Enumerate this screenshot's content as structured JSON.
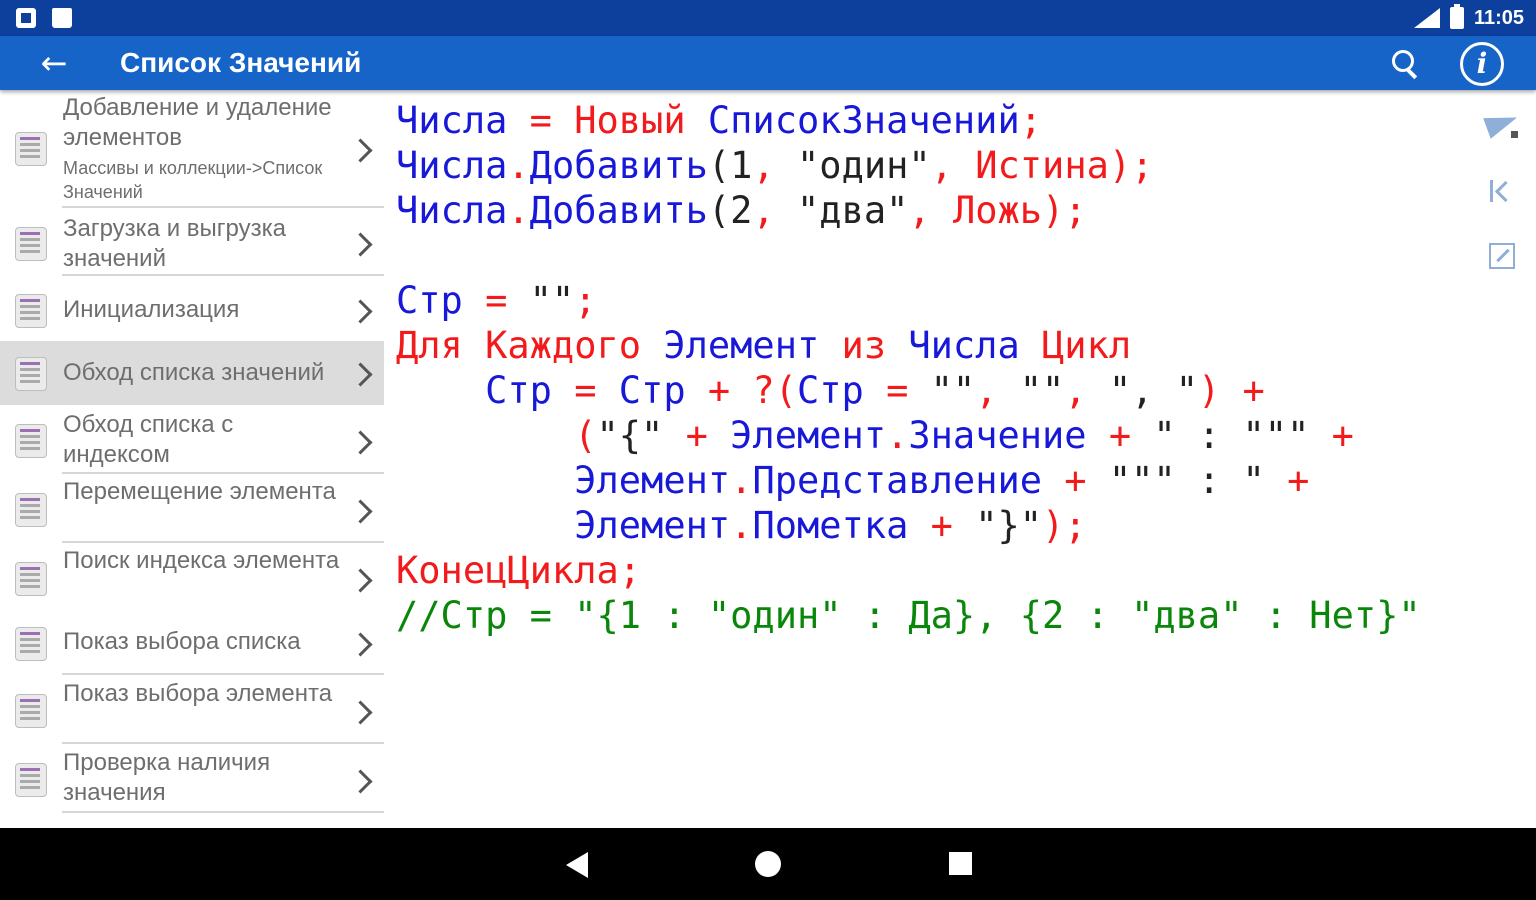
{
  "status_bar": {
    "time": "11:05"
  },
  "app_bar": {
    "title": "Список Значений",
    "back_icon": "arrow-back-icon",
    "search_icon": "search-icon",
    "info_icon": "info-icon",
    "info_glyph": "i"
  },
  "sidebar": {
    "items": [
      {
        "label": "Добавление и удаление элементов",
        "sub": "Массивы и коллекции->Список Значений"
      },
      {
        "label": "Загрузка и выгрузка значений"
      },
      {
        "label": "Инициализация"
      },
      {
        "label": "Обход списка значений"
      },
      {
        "label": "Обход списка с индексом"
      },
      {
        "label": "Перемещение элемента"
      },
      {
        "label": "Поиск индекса элемента"
      },
      {
        "label": "Показ выбора списка"
      },
      {
        "label": "Показ выбора элемента"
      },
      {
        "label": "Проверка наличия значения"
      }
    ],
    "selected_index": 3
  },
  "code": {
    "colors": {
      "keyword": "#f21a1a",
      "identifier": "#1818d8",
      "literal": "#222222",
      "comment": "#0a870a"
    },
    "lines": [
      [
        [
          "blue",
          "Числа"
        ],
        [
          "red",
          " = Новый "
        ],
        [
          "blue",
          "СписокЗначений"
        ],
        [
          "red",
          ";"
        ]
      ],
      [
        [
          "blue",
          "Числа"
        ],
        [
          "red",
          "."
        ],
        [
          "blue",
          "Добавить"
        ],
        [
          "blk",
          "(1"
        ],
        [
          "red",
          ", "
        ],
        [
          "blk",
          "\"один\""
        ],
        [
          "red",
          ", Истина);"
        ]
      ],
      [
        [
          "blue",
          "Числа"
        ],
        [
          "red",
          "."
        ],
        [
          "blue",
          "Добавить"
        ],
        [
          "blk",
          "(2"
        ],
        [
          "red",
          ", "
        ],
        [
          "blk",
          "\"два\""
        ],
        [
          "red",
          ", Ложь);"
        ]
      ],
      [],
      [
        [
          "blue",
          "Стр"
        ],
        [
          "red",
          " = "
        ],
        [
          "blk",
          "\"\""
        ],
        [
          "red",
          ";"
        ]
      ],
      [
        [
          "red",
          "Для Каждого "
        ],
        [
          "blue",
          "Элемент"
        ],
        [
          "red",
          " из "
        ],
        [
          "blue",
          "Числа"
        ],
        [
          "red",
          " Цикл"
        ]
      ],
      [
        [
          "blk",
          "    "
        ],
        [
          "blue",
          "Стр"
        ],
        [
          "red",
          " = "
        ],
        [
          "blue",
          "Стр"
        ],
        [
          "red",
          " + ?("
        ],
        [
          "blue",
          "Стр"
        ],
        [
          "red",
          " = "
        ],
        [
          "blk",
          "\"\""
        ],
        [
          "red",
          ", "
        ],
        [
          "blk",
          "\"\""
        ],
        [
          "red",
          ", "
        ],
        [
          "blk",
          "\", \""
        ],
        [
          "red",
          ") +"
        ]
      ],
      [
        [
          "blk",
          "        "
        ],
        [
          "red",
          "("
        ],
        [
          "blk",
          "\"{\""
        ],
        [
          "red",
          " + "
        ],
        [
          "blue",
          "Элемент"
        ],
        [
          "red",
          "."
        ],
        [
          "blue",
          "Значение"
        ],
        [
          "red",
          " + "
        ],
        [
          "blk",
          "\" : \"\"\""
        ],
        [
          "red",
          " +"
        ]
      ],
      [
        [
          "blk",
          "        "
        ],
        [
          "blue",
          "Элемент"
        ],
        [
          "red",
          "."
        ],
        [
          "blue",
          "Представление"
        ],
        [
          "red",
          " + "
        ],
        [
          "blk",
          "\"\"\" : \""
        ],
        [
          "red",
          " +"
        ]
      ],
      [
        [
          "blk",
          "        "
        ],
        [
          "blue",
          "Элемент"
        ],
        [
          "red",
          "."
        ],
        [
          "blue",
          "Пометка"
        ],
        [
          "red",
          " + "
        ],
        [
          "blk",
          "\"}\""
        ],
        [
          "red",
          ");"
        ]
      ],
      [
        [
          "red",
          "КонецЦикла;"
        ]
      ],
      [
        [
          "green",
          "//Стр = \"{1 : \"один\" : Да}, {2 : \"два\" : Нет}\""
        ]
      ]
    ]
  },
  "tools": [
    "send-icon",
    "first-page-icon",
    "wrap-icon"
  ],
  "nav": {
    "back": "nav-back-icon",
    "home": "nav-home-icon",
    "recent": "nav-recent-icon"
  }
}
